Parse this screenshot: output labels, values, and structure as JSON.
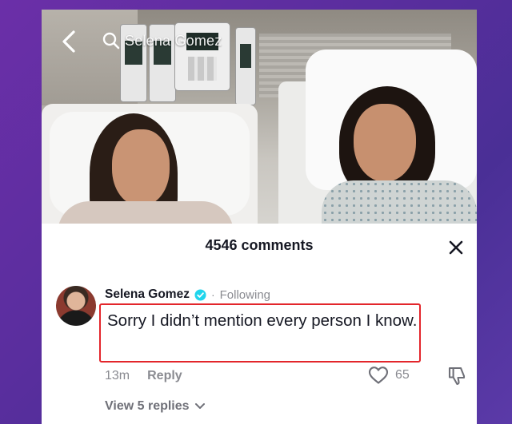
{
  "header": {
    "search_text": "Selena Gomez"
  },
  "sheet": {
    "comments_count": "4546 comments"
  },
  "comment": {
    "username": "Selena Gomez",
    "separator": "·",
    "following_label": "Following",
    "text": "Sorry I didn’t mention every person I know.",
    "time": "13m",
    "reply_label": "Reply",
    "like_count": "65",
    "view_replies": "View 5 replies"
  },
  "colors": {
    "highlight_border": "#e3262b",
    "verified_blue": "#20d5ec",
    "text_primary": "#161823",
    "text_secondary": "#8a8b91"
  },
  "icons": [
    "back-arrow-icon",
    "search-icon",
    "close-icon",
    "verified-badge-icon",
    "heart-icon",
    "dislike-icon",
    "chevron-down-icon"
  ]
}
